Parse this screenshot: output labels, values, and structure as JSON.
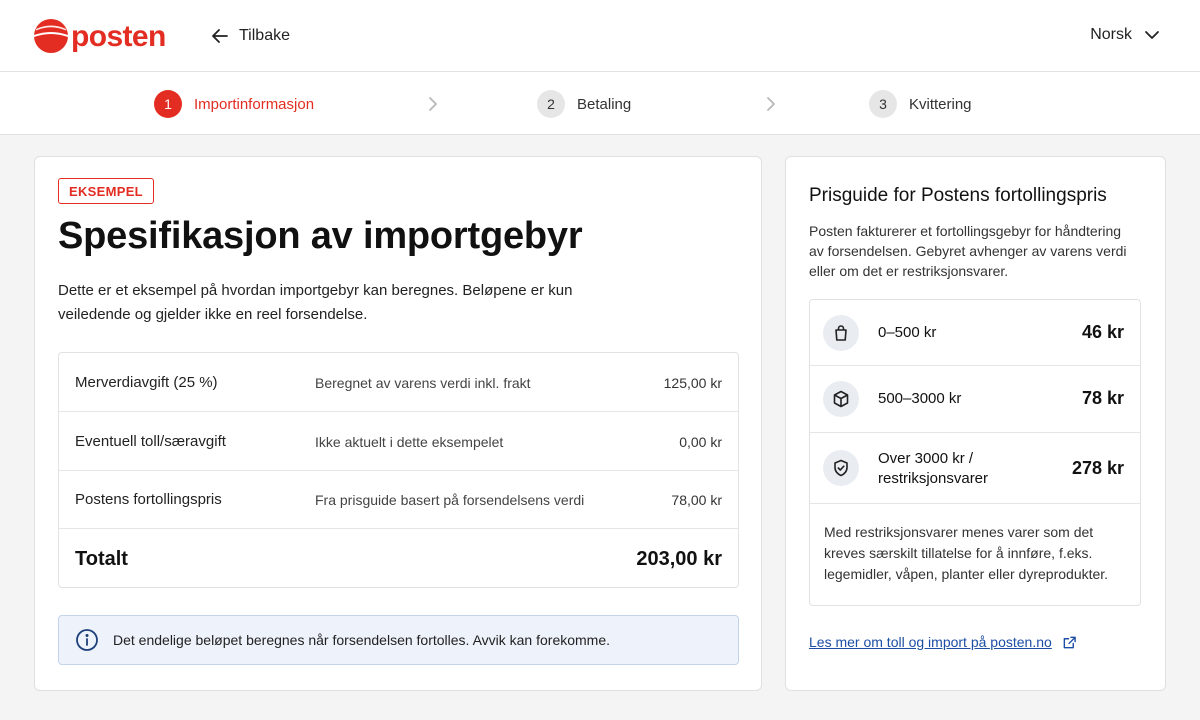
{
  "header": {
    "logo_text": "posten",
    "back_label": "Tilbake",
    "language": "Norsk"
  },
  "stepper": {
    "steps": [
      {
        "number": "1",
        "label": "Importinformasjon",
        "state": "active"
      },
      {
        "number": "2",
        "label": "Betaling",
        "state": "inactive"
      },
      {
        "number": "3",
        "label": "Kvittering",
        "state": "inactive"
      }
    ]
  },
  "main": {
    "badge": "EKSEMPEL",
    "title": "Spesifikasjon av importgebyr",
    "intro": "Dette er et eksempel på hvordan importgebyr kan beregnes. Beløpene er kun veiledende og gjelder ikke en reel forsendelse.",
    "rows": [
      {
        "label": "Merverdiavgift (25 %)",
        "description": "Beregnet av varens verdi inkl. frakt",
        "amount": "125,00 kr"
      },
      {
        "label": "Eventuell toll/særavgift",
        "description": "Ikke aktuelt i dette eksempelet",
        "amount": "0,00 kr"
      },
      {
        "label": "Postens fortollingspris",
        "description": "Fra prisguide basert på forsendelsens verdi",
        "amount": "78,00 kr"
      }
    ],
    "total": {
      "label": "Totalt",
      "amount": "203,00 kr"
    },
    "info": "Det endelige beløpet beregnes når forsendelsen fortolles. Avvik kan forekomme."
  },
  "side": {
    "title": "Prisguide for Postens fortollingspris",
    "description": "Posten fakturerer et fortollingsgebyr for håndtering av forsendelsen. Gebyret avhenger av varens verdi eller om det er restriksjonsvarer.",
    "tiers": [
      {
        "icon": "shopping-bag-icon",
        "range": "0–500 kr",
        "price": "46 kr"
      },
      {
        "icon": "package-box-icon",
        "range": "500–3000 kr",
        "price": "78 kr"
      },
      {
        "icon": "shield-check-icon",
        "range_line1": "Over 3000 kr /",
        "range_line2": "restriksjonsvarer",
        "price": "278 kr"
      }
    ],
    "note": "Med restriksjonsvarer menes varer som det kreves særskilt tillatelse for å innføre, f.eks. legemidler, våpen, planter eller dyreprodukter.",
    "link": "Les mer om toll og import på posten.no"
  },
  "colors": {
    "brand_red": "#e32d22",
    "link_blue": "#1d4ea5",
    "info_bg": "#edf2fb"
  }
}
